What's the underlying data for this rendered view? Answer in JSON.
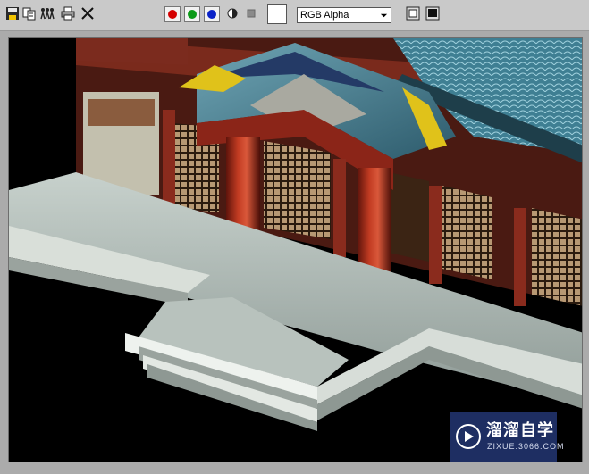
{
  "toolbar": {
    "buttons": [
      {
        "name": "save-icon"
      },
      {
        "name": "clone-icon"
      },
      {
        "name": "channels-people-icon"
      },
      {
        "name": "print-icon"
      },
      {
        "name": "clear-icon"
      }
    ],
    "channels": [
      {
        "name": "red-channel",
        "color": "#d40000"
      },
      {
        "name": "green-channel",
        "color": "#0c9a18"
      },
      {
        "name": "blue-channel",
        "color": "#0a22c8"
      }
    ],
    "swatch_color": "#ffffff",
    "channel_select": {
      "value": "RGB Alpha"
    }
  },
  "watermark": {
    "name": "溜溜自学",
    "url": "ZIXUE.3066.COM"
  }
}
